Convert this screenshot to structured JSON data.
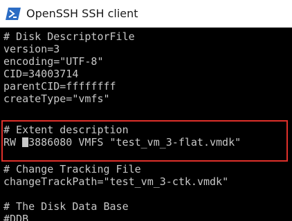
{
  "window": {
    "title": "OpenSSH SSH client",
    "icon": "powershell-icon"
  },
  "colors": {
    "terminal_bg": "#000000",
    "terminal_fg": "#c8c8c8",
    "highlight": "#e0302a"
  },
  "terminal": {
    "lines": [
      "# Disk DescriptorFile",
      "version=3",
      "encoding=\"UTF-8\"",
      "CID=34003714",
      "parentCID=ffffffff",
      "createType=\"vmfs\"",
      "",
      "# Extent description",
      "RW 83886080 VMFS \"test_vm_3-flat.vmdk\"",
      "",
      "# Change Tracking File",
      "changeTrackPath=\"test_vm_3-ctk.vmdk\"",
      "",
      "# The Disk Data Base",
      "#DDB"
    ],
    "extent_prefix": "RW ",
    "extent_rest": "3886080 VMFS \"test_vm_3-flat.vmdk\""
  }
}
